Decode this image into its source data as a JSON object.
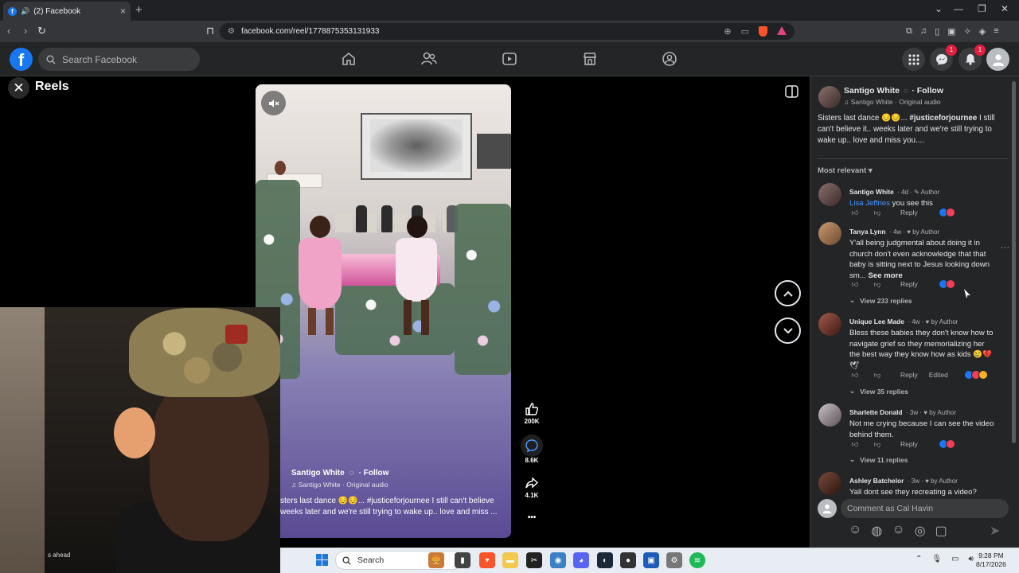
{
  "browser": {
    "tab_title": "(2) Facebook",
    "url": "facebook.com/reel/1778875353131933",
    "new_tab": "+",
    "win_min": "—",
    "win_max": "❐",
    "win_close": "✕"
  },
  "fb": {
    "logo": "f",
    "search_placeholder": "Search Facebook",
    "messenger_badge": "1",
    "notifications_badge": "1"
  },
  "reels": {
    "title": "Reels",
    "video": {
      "author": "Santigo White",
      "follow": "· Follow",
      "audio": "♫ Santigo White · Original audio",
      "caption": "sters last dance 😔😔... #justiceforjournee I still can't believe weeks later and we're still trying to wake up.. love and miss ...",
      "likes": "200K",
      "comments": "8.6K",
      "shares": "4.1K",
      "more": "•••"
    },
    "webcam_text": "s ahead"
  },
  "panel": {
    "author": "Santigo White",
    "follow": "· Follow",
    "audio": "♫ Santigo White · Original audio",
    "caption_prefix": "Sisters last dance 😔😔... ",
    "caption_hashtag": "#justiceforjournee",
    "caption_suffix": " I still can't believe it.. weeks later and we're still trying to wake up.. love and miss you....",
    "sort_label": "Most relevant ▾",
    "comments": [
      {
        "name": "Santigo White",
        "meta": "· 4d · ✎ Author",
        "mention": "Lisa Jeffries",
        "text": " you see this",
        "reply": "Reply"
      },
      {
        "name": "Tanya Lynn",
        "meta": "· 4w · ♥ by Author",
        "text": "Y'all being judgmental about doing it in church don't even acknowledge that that baby is sitting next to Jesus looking down sm...",
        "see_more": "See more",
        "reply": "Reply",
        "view_replies": "View 233 replies"
      },
      {
        "name": "Unique Lee Made",
        "meta": "· 4w · ♥ by Author",
        "text": "Bless these babies they don't know how to navigate grief so they memorializing her the best way they know how as kids 😢💔🕊",
        "reply": "Reply",
        "edited": "Edited",
        "view_replies": "View 35 replies"
      },
      {
        "name": "Sharlette Donald",
        "meta": "· 3w · ♥ by Author",
        "text": "Not me crying because I can see the video behind them.",
        "reply": "Reply",
        "view_replies": "View 11 replies"
      },
      {
        "name": "Ashley Batchelor",
        "meta": "· 3w · ♥ by Author",
        "text": "Yall dont see they recreating a video?"
      }
    ],
    "comment_placeholder": "Comment as Cal Havin"
  },
  "taskbar": {
    "search": "Search",
    "time": "9:28 PM",
    "date": "8/17/2026"
  }
}
